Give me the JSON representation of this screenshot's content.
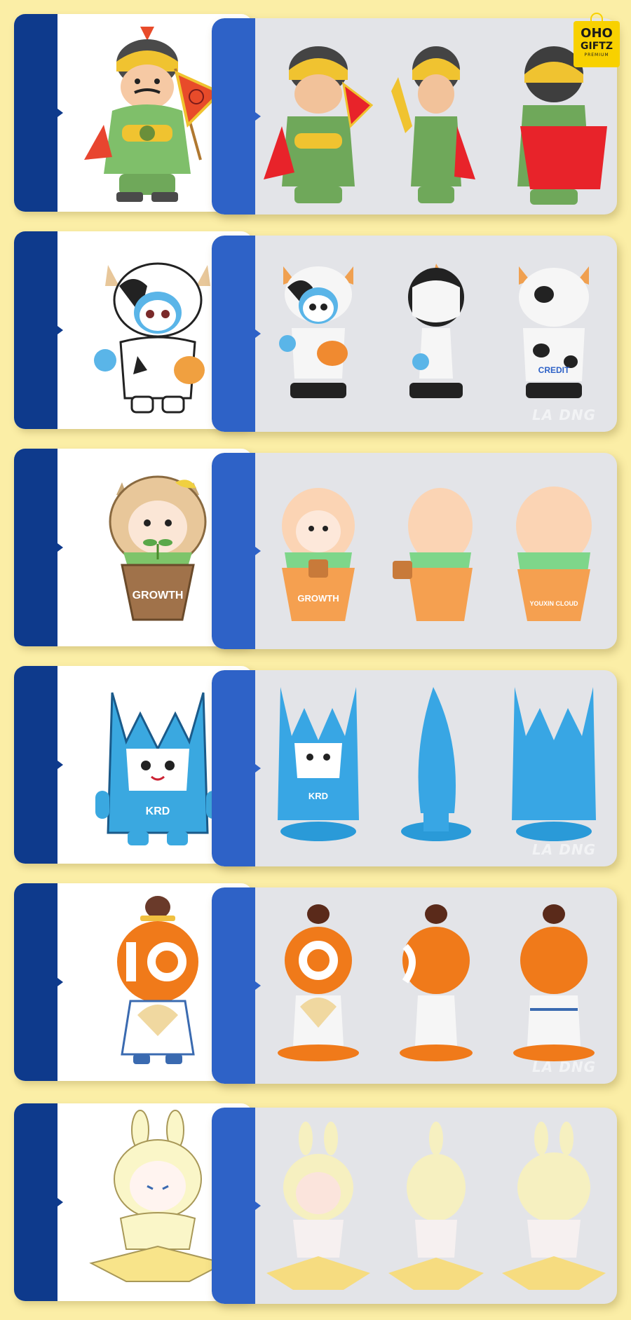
{
  "brand": {
    "line1": "OHO",
    "line2": "GIFTZ",
    "line3": "PREMIUM"
  },
  "watermark_text": "LA DNG",
  "colors": {
    "background": "#fbeea6",
    "left_strip": "#0e3a8c",
    "right_strip": "#2e62c7",
    "photo_bg": "#e3e4e8"
  },
  "rows": [
    {
      "character": "general-warrior",
      "sketch_label": "",
      "photo_labels": [
        "",
        "",
        ""
      ]
    },
    {
      "character": "cow-mascot",
      "sketch_label": "",
      "photo_labels": [
        "",
        "",
        "CREDIT"
      ]
    },
    {
      "character": "growth-sprout",
      "sketch_label": "GROWTH",
      "photo_labels": [
        "GROWTH",
        "",
        "YOUXIN CLOUD"
      ]
    },
    {
      "character": "krd-blue-monster",
      "sketch_label": "KRD",
      "photo_labels": [
        "KRD",
        "",
        ""
      ]
    },
    {
      "character": "orange-ten-mascot",
      "sketch_label": "",
      "photo_labels": [
        "",
        "",
        ""
      ]
    },
    {
      "character": "unicorn-bunny-girl",
      "sketch_label": "",
      "photo_labels": [
        "",
        "",
        ""
      ]
    }
  ]
}
